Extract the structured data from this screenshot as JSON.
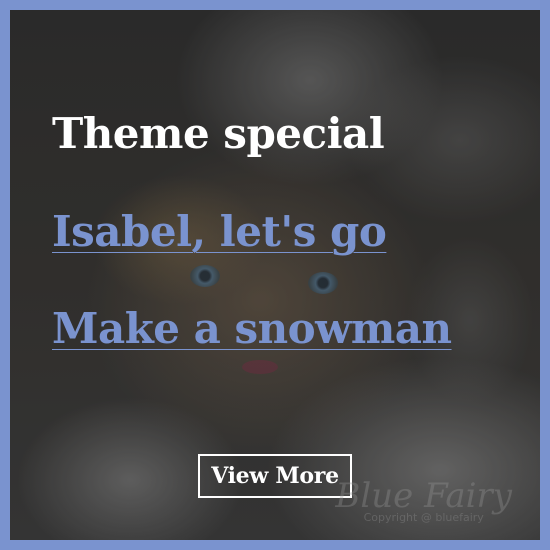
{
  "card": {
    "heading": "Theme special",
    "links": [
      {
        "label": "Isabel, let's go"
      },
      {
        "label": "Make a snowman"
      }
    ],
    "button_label": "View More",
    "watermark": {
      "title": "Blue Fairy",
      "copyright": "Copyright @ bluefairy"
    }
  },
  "colors": {
    "border": "#7a93cf",
    "link": "#7a93cf",
    "heading": "#ffffff",
    "button": "#ffffff"
  }
}
